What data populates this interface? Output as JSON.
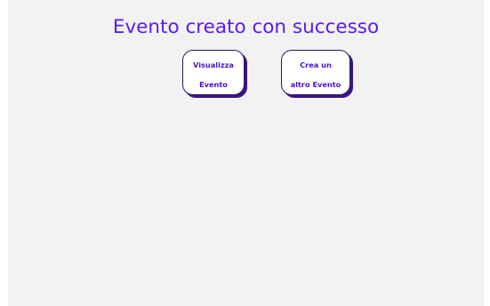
{
  "page": {
    "title": "Evento creato con successo"
  },
  "actions": {
    "view_event": {
      "line1": "Visualizza",
      "line2": "Evento"
    },
    "create_event": {
      "line1": "Crea un",
      "line2": "altro Evento"
    }
  },
  "colors": {
    "title": "#5a1cf0",
    "button_text": "#4b10d4",
    "button_shadow": "#3a1686",
    "panel_background": "#f2f2f2"
  }
}
